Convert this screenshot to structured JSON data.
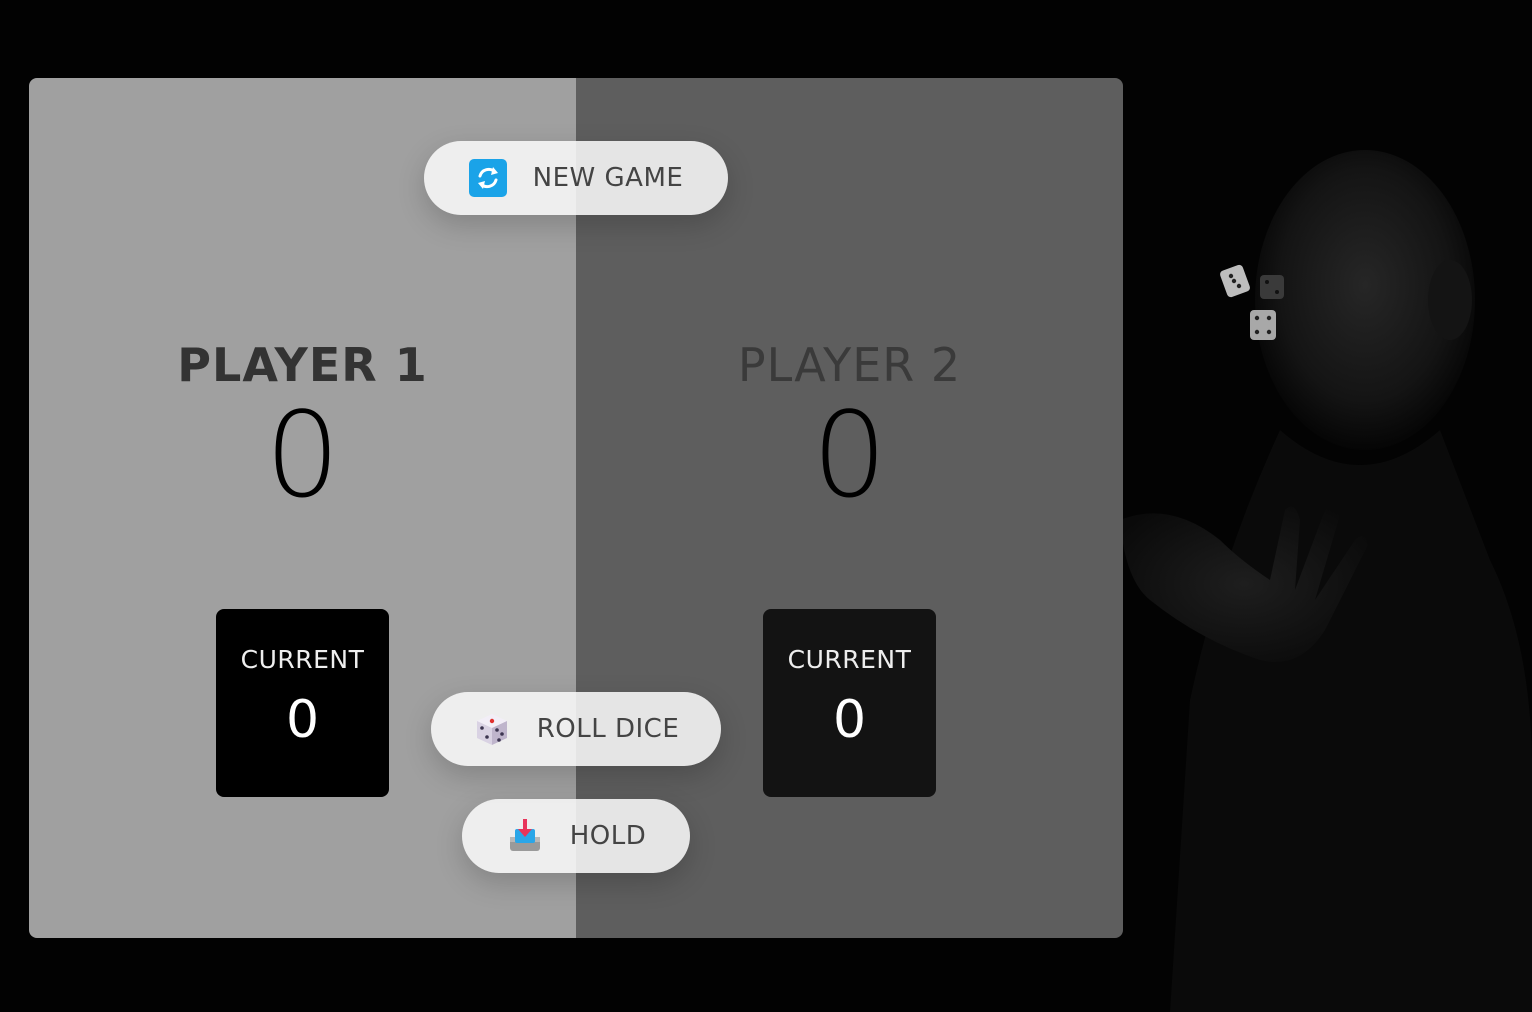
{
  "players": [
    {
      "name": "PLAYER 1",
      "total_score": "0",
      "current_label": "CURRENT",
      "current_score": "0",
      "active": true
    },
    {
      "name": "PLAYER 2",
      "total_score": "0",
      "current_label": "CURRENT",
      "current_score": "0",
      "active": false
    }
  ],
  "buttons": {
    "new_game": {
      "label": "NEW GAME",
      "icon": "refresh-icon"
    },
    "roll_dice": {
      "label": "ROLL DICE",
      "icon": "dice-icon"
    },
    "hold": {
      "label": "HOLD",
      "icon": "inbox-tray-icon"
    }
  },
  "colors": {
    "active_panel": "#a0a0a0",
    "inactive_panel": "#5e5e5e",
    "background": "#020202"
  }
}
